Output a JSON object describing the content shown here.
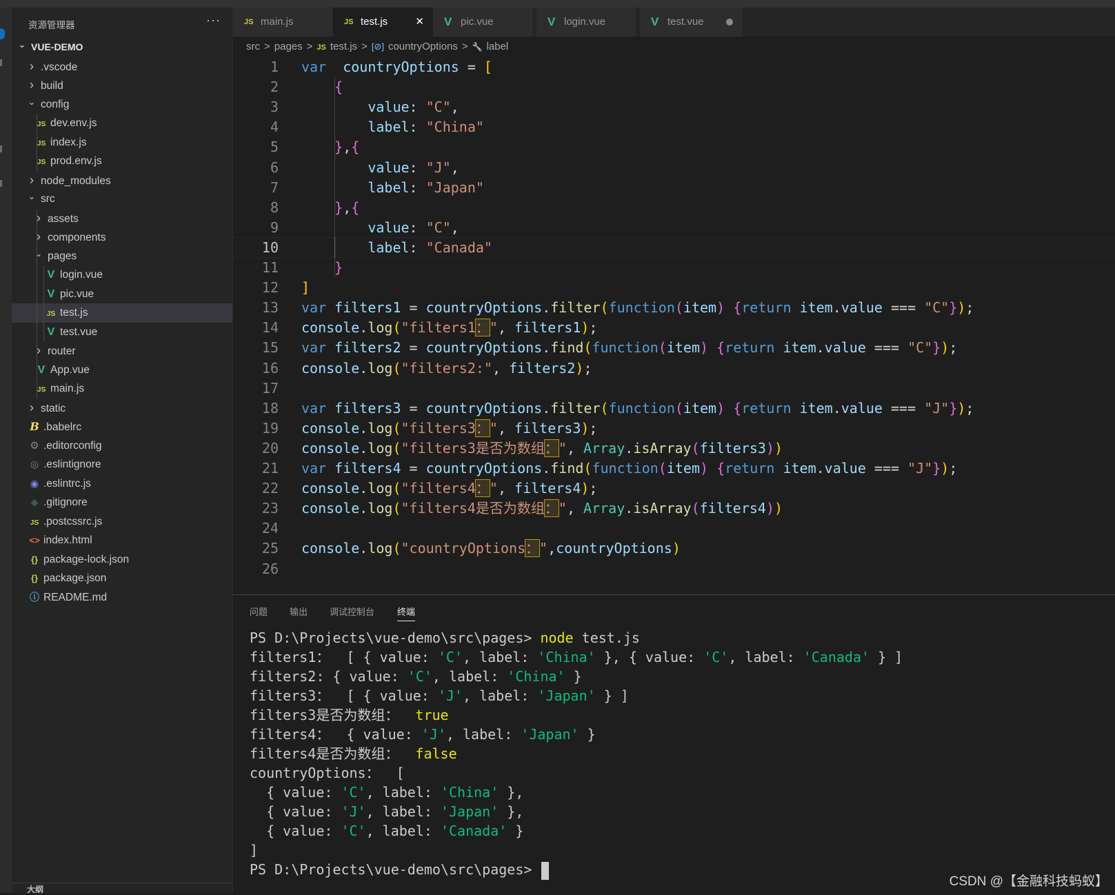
{
  "sidebar": {
    "title": "资源管理器",
    "more": "···",
    "outline_label": "大纲",
    "tree": [
      {
        "label": "VUE-DEMO",
        "depth": 0,
        "chevron": "down",
        "icon": "",
        "root": true
      },
      {
        "label": ".vscode",
        "depth": 1,
        "chevron": "right",
        "icon": ""
      },
      {
        "label": "build",
        "depth": 1,
        "chevron": "right",
        "icon": ""
      },
      {
        "label": "config",
        "depth": 1,
        "chevron": "down",
        "icon": ""
      },
      {
        "label": "dev.env.js",
        "depth": 2,
        "chevron": "",
        "icon": "js"
      },
      {
        "label": "index.js",
        "depth": 2,
        "chevron": "",
        "icon": "js"
      },
      {
        "label": "prod.env.js",
        "depth": 2,
        "chevron": "",
        "icon": "js"
      },
      {
        "label": "node_modules",
        "depth": 1,
        "chevron": "right",
        "icon": ""
      },
      {
        "label": "src",
        "depth": 1,
        "chevron": "down",
        "icon": ""
      },
      {
        "label": "assets",
        "depth": 2,
        "chevron": "right",
        "icon": ""
      },
      {
        "label": "components",
        "depth": 2,
        "chevron": "right",
        "icon": ""
      },
      {
        "label": "pages",
        "depth": 2,
        "chevron": "down",
        "icon": ""
      },
      {
        "label": "login.vue",
        "depth": 3,
        "chevron": "",
        "icon": "vue"
      },
      {
        "label": "pic.vue",
        "depth": 3,
        "chevron": "",
        "icon": "vue"
      },
      {
        "label": "test.js",
        "depth": 3,
        "chevron": "",
        "icon": "js",
        "selected": true
      },
      {
        "label": "test.vue",
        "depth": 3,
        "chevron": "",
        "icon": "vue"
      },
      {
        "label": "router",
        "depth": 2,
        "chevron": "right",
        "icon": ""
      },
      {
        "label": "App.vue",
        "depth": 2,
        "chevron": "",
        "icon": "vue"
      },
      {
        "label": "main.js",
        "depth": 2,
        "chevron": "",
        "icon": "js"
      },
      {
        "label": "static",
        "depth": 1,
        "chevron": "right",
        "icon": ""
      },
      {
        "label": ".babelrc",
        "depth": 1,
        "chevron": "",
        "icon": "babel"
      },
      {
        "label": ".editorconfig",
        "depth": 1,
        "chevron": "",
        "icon": "gear"
      },
      {
        "label": ".eslintignore",
        "depth": 1,
        "chevron": "",
        "icon": "eslint"
      },
      {
        "label": ".eslintrc.js",
        "depth": 1,
        "chevron": "",
        "icon": "eslintrc"
      },
      {
        "label": ".gitignore",
        "depth": 1,
        "chevron": "",
        "icon": "git"
      },
      {
        "label": ".postcssrc.js",
        "depth": 1,
        "chevron": "",
        "icon": "js"
      },
      {
        "label": "index.html",
        "depth": 1,
        "chevron": "",
        "icon": "html"
      },
      {
        "label": "package-lock.json",
        "depth": 1,
        "chevron": "",
        "icon": "json"
      },
      {
        "label": "package.json",
        "depth": 1,
        "chevron": "",
        "icon": "json"
      },
      {
        "label": "README.md",
        "depth": 1,
        "chevron": "",
        "icon": "info"
      }
    ]
  },
  "tabs": [
    {
      "label": "main.js",
      "icon": "js",
      "active": false,
      "state": ""
    },
    {
      "label": "test.js",
      "icon": "js",
      "active": true,
      "state": "close"
    },
    {
      "label": "pic.vue",
      "icon": "vue",
      "active": false,
      "state": ""
    },
    {
      "label": "login.vue",
      "icon": "vue",
      "active": false,
      "state": ""
    },
    {
      "label": "test.vue",
      "icon": "vue",
      "active": false,
      "state": "dirty"
    }
  ],
  "breadcrumb": {
    "segments": [
      "src",
      "pages",
      "test.js",
      "countryOptions",
      "label"
    ],
    "separator": ">"
  },
  "editor": {
    "current_line": 10,
    "lines": [
      [
        [
          "kw",
          "var"
        ],
        [
          "",
          "  "
        ],
        [
          "var",
          "countryOptions"
        ],
        [
          "",
          " = "
        ],
        [
          "b1",
          "["
        ]
      ],
      [
        [
          "",
          "    "
        ],
        [
          "b2",
          "{"
        ]
      ],
      [
        [
          "",
          "        "
        ],
        [
          "var",
          "value"
        ],
        [
          "",
          ": "
        ],
        [
          "str",
          "\"C\""
        ],
        [
          "",
          ","
        ]
      ],
      [
        [
          "",
          "        "
        ],
        [
          "var",
          "label"
        ],
        [
          "",
          ": "
        ],
        [
          "str",
          "\"China\""
        ]
      ],
      [
        [
          "",
          "    "
        ],
        [
          "b2",
          "}"
        ],
        [
          "",
          ","
        ],
        [
          "b2",
          "{"
        ]
      ],
      [
        [
          "",
          "        "
        ],
        [
          "var",
          "value"
        ],
        [
          "",
          ": "
        ],
        [
          "str",
          "\"J\""
        ],
        [
          "",
          ","
        ]
      ],
      [
        [
          "",
          "        "
        ],
        [
          "var",
          "label"
        ],
        [
          "",
          ": "
        ],
        [
          "str",
          "\"Japan\""
        ]
      ],
      [
        [
          "",
          "    "
        ],
        [
          "b2",
          "}"
        ],
        [
          "",
          ","
        ],
        [
          "b2",
          "{"
        ]
      ],
      [
        [
          "",
          "        "
        ],
        [
          "var",
          "value"
        ],
        [
          "",
          ": "
        ],
        [
          "str",
          "\"C\""
        ],
        [
          "",
          ","
        ]
      ],
      [
        [
          "",
          "        "
        ],
        [
          "var",
          "label"
        ],
        [
          "",
          ": "
        ],
        [
          "str",
          "\"Canada\""
        ]
      ],
      [
        [
          "",
          "    "
        ],
        [
          "b2",
          "}"
        ]
      ],
      [
        [
          "b1",
          "]"
        ]
      ],
      [
        [
          "kw",
          "var"
        ],
        [
          "",
          " "
        ],
        [
          "var",
          "filters1"
        ],
        [
          "",
          " = "
        ],
        [
          "var",
          "countryOptions"
        ],
        [
          "",
          "."
        ],
        [
          "fn",
          "filter"
        ],
        [
          "b1",
          "("
        ],
        [
          "kw",
          "function"
        ],
        [
          "b2",
          "("
        ],
        [
          "var",
          "item"
        ],
        [
          "b2",
          ")"
        ],
        [
          "",
          " "
        ],
        [
          "b2",
          "{"
        ],
        [
          "kw",
          "return"
        ],
        [
          "",
          " "
        ],
        [
          "var",
          "item"
        ],
        [
          "",
          "."
        ],
        [
          "var",
          "value"
        ],
        [
          "",
          " === "
        ],
        [
          "str",
          "\"C\""
        ],
        [
          "b2",
          "}"
        ],
        [
          "b1",
          ")"
        ],
        [
          "",
          ";"
        ]
      ],
      [
        [
          "var",
          "console"
        ],
        [
          "",
          "."
        ],
        [
          "fn",
          "log"
        ],
        [
          "b1",
          "("
        ],
        [
          "str",
          "\"filters1"
        ],
        [
          "strhl",
          "："
        ],
        [
          "str",
          "\""
        ],
        [
          "",
          ", "
        ],
        [
          "var",
          "filters1"
        ],
        [
          "b1",
          ")"
        ],
        [
          "",
          ";"
        ]
      ],
      [
        [
          "kw",
          "var"
        ],
        [
          "",
          " "
        ],
        [
          "var",
          "filters2"
        ],
        [
          "",
          " = "
        ],
        [
          "var",
          "countryOptions"
        ],
        [
          "",
          "."
        ],
        [
          "fn",
          "find"
        ],
        [
          "b1",
          "("
        ],
        [
          "kw",
          "function"
        ],
        [
          "b2",
          "("
        ],
        [
          "var",
          "item"
        ],
        [
          "b2",
          ")"
        ],
        [
          "",
          " "
        ],
        [
          "b2",
          "{"
        ],
        [
          "kw",
          "return"
        ],
        [
          "",
          " "
        ],
        [
          "var",
          "item"
        ],
        [
          "",
          "."
        ],
        [
          "var",
          "value"
        ],
        [
          "",
          " === "
        ],
        [
          "str",
          "\"C\""
        ],
        [
          "b2",
          "}"
        ],
        [
          "b1",
          ")"
        ],
        [
          "",
          ";"
        ]
      ],
      [
        [
          "var",
          "console"
        ],
        [
          "",
          "."
        ],
        [
          "fn",
          "log"
        ],
        [
          "b1",
          "("
        ],
        [
          "str",
          "\"filters2:\""
        ],
        [
          "",
          ", "
        ],
        [
          "var",
          "filters2"
        ],
        [
          "b1",
          ")"
        ],
        [
          "",
          ";"
        ]
      ],
      [],
      [
        [
          "kw",
          "var"
        ],
        [
          "",
          " "
        ],
        [
          "var",
          "filters3"
        ],
        [
          "",
          " = "
        ],
        [
          "var",
          "countryOptions"
        ],
        [
          "",
          "."
        ],
        [
          "fn",
          "filter"
        ],
        [
          "b1",
          "("
        ],
        [
          "kw",
          "function"
        ],
        [
          "b2",
          "("
        ],
        [
          "var",
          "item"
        ],
        [
          "b2",
          ")"
        ],
        [
          "",
          " "
        ],
        [
          "b2",
          "{"
        ],
        [
          "kw",
          "return"
        ],
        [
          "",
          " "
        ],
        [
          "var",
          "item"
        ],
        [
          "",
          "."
        ],
        [
          "var",
          "value"
        ],
        [
          "",
          " === "
        ],
        [
          "str",
          "\"J\""
        ],
        [
          "b2",
          "}"
        ],
        [
          "b1",
          ")"
        ],
        [
          "",
          ";"
        ]
      ],
      [
        [
          "var",
          "console"
        ],
        [
          "",
          "."
        ],
        [
          "fn",
          "log"
        ],
        [
          "b1",
          "("
        ],
        [
          "str",
          "\"filters3"
        ],
        [
          "strhl",
          "："
        ],
        [
          "str",
          "\""
        ],
        [
          "",
          ", "
        ],
        [
          "var",
          "filters3"
        ],
        [
          "b1",
          ")"
        ],
        [
          "",
          ";"
        ]
      ],
      [
        [
          "var",
          "console"
        ],
        [
          "",
          "."
        ],
        [
          "fn",
          "log"
        ],
        [
          "b1",
          "("
        ],
        [
          "str",
          "\"filters3是否为数组"
        ],
        [
          "strhl",
          "："
        ],
        [
          "str",
          "\""
        ],
        [
          "",
          ", "
        ],
        [
          "type",
          "Array"
        ],
        [
          "",
          "."
        ],
        [
          "fn",
          "isArray"
        ],
        [
          "b2",
          "("
        ],
        [
          "var",
          "filters3"
        ],
        [
          "b2",
          ")"
        ],
        [
          "b1",
          ")"
        ]
      ],
      [
        [
          "kw",
          "var"
        ],
        [
          "",
          " "
        ],
        [
          "var",
          "filters4"
        ],
        [
          "",
          " = "
        ],
        [
          "var",
          "countryOptions"
        ],
        [
          "",
          "."
        ],
        [
          "fn",
          "find"
        ],
        [
          "b1",
          "("
        ],
        [
          "kw",
          "function"
        ],
        [
          "b2",
          "("
        ],
        [
          "var",
          "item"
        ],
        [
          "b2",
          ")"
        ],
        [
          "",
          " "
        ],
        [
          "b2",
          "{"
        ],
        [
          "kw",
          "return"
        ],
        [
          "",
          " "
        ],
        [
          "var",
          "item"
        ],
        [
          "",
          "."
        ],
        [
          "var",
          "value"
        ],
        [
          "",
          " === "
        ],
        [
          "str",
          "\"J\""
        ],
        [
          "b2",
          "}"
        ],
        [
          "b1",
          ")"
        ],
        [
          "",
          ";"
        ]
      ],
      [
        [
          "var",
          "console"
        ],
        [
          "",
          "."
        ],
        [
          "fn",
          "log"
        ],
        [
          "b1",
          "("
        ],
        [
          "str",
          "\"filters4"
        ],
        [
          "strhl",
          "："
        ],
        [
          "str",
          "\""
        ],
        [
          "",
          ", "
        ],
        [
          "var",
          "filters4"
        ],
        [
          "b1",
          ")"
        ],
        [
          "",
          ";"
        ]
      ],
      [
        [
          "var",
          "console"
        ],
        [
          "",
          "."
        ],
        [
          "fn",
          "log"
        ],
        [
          "b1",
          "("
        ],
        [
          "str",
          "\"filters4是否为数组"
        ],
        [
          "strhl",
          "："
        ],
        [
          "str",
          "\""
        ],
        [
          "",
          ", "
        ],
        [
          "type",
          "Array"
        ],
        [
          "",
          "."
        ],
        [
          "fn",
          "isArray"
        ],
        [
          "b2",
          "("
        ],
        [
          "var",
          "filters4"
        ],
        [
          "b2",
          ")"
        ],
        [
          "b1",
          ")"
        ]
      ],
      [],
      [
        [
          "var",
          "console"
        ],
        [
          "",
          "."
        ],
        [
          "fn",
          "log"
        ],
        [
          "b1",
          "("
        ],
        [
          "str",
          "\"countryOptions"
        ],
        [
          "strhl",
          "："
        ],
        [
          "str",
          "\""
        ],
        [
          "",
          ","
        ],
        [
          "var",
          "countryOptions"
        ],
        [
          "b1",
          ")"
        ]
      ],
      []
    ]
  },
  "panel": {
    "tabs": [
      "问题",
      "输出",
      "调试控制台",
      "终端"
    ],
    "active_tab": 3,
    "terminal": [
      [
        [
          "",
          "PS D:\\Projects\\vue-demo\\src\\pages> "
        ],
        [
          "y",
          "node"
        ],
        [
          "",
          " test.js"
        ]
      ],
      [
        [
          "",
          "filters1：  [ { value: "
        ],
        [
          "g",
          "'C'"
        ],
        [
          "",
          ", label: "
        ],
        [
          "g",
          "'China'"
        ],
        [
          "",
          " }, { value: "
        ],
        [
          "g",
          "'C'"
        ],
        [
          "",
          ", label: "
        ],
        [
          "g",
          "'Canada'"
        ],
        [
          "",
          " } ]"
        ]
      ],
      [
        [
          "",
          "filters2: { value: "
        ],
        [
          "g",
          "'C'"
        ],
        [
          "",
          ", label: "
        ],
        [
          "g",
          "'China'"
        ],
        [
          "",
          " }"
        ]
      ],
      [
        [
          "",
          "filters3：  [ { value: "
        ],
        [
          "g",
          "'J'"
        ],
        [
          "",
          ", label: "
        ],
        [
          "g",
          "'Japan'"
        ],
        [
          "",
          " } ]"
        ]
      ],
      [
        [
          "",
          "filters3是否为数组：  "
        ],
        [
          "y",
          "true"
        ]
      ],
      [
        [
          "",
          "filters4：  { value: "
        ],
        [
          "g",
          "'J'"
        ],
        [
          "",
          ", label: "
        ],
        [
          "g",
          "'Japan'"
        ],
        [
          "",
          " }"
        ]
      ],
      [
        [
          "",
          "filters4是否为数组：  "
        ],
        [
          "y",
          "false"
        ]
      ],
      [
        [
          "",
          "countryOptions：  ["
        ]
      ],
      [
        [
          "",
          "  { value: "
        ],
        [
          "g",
          "'C'"
        ],
        [
          "",
          ", label: "
        ],
        [
          "g",
          "'China'"
        ],
        [
          "",
          " },"
        ]
      ],
      [
        [
          "",
          "  { value: "
        ],
        [
          "g",
          "'J'"
        ],
        [
          "",
          ", label: "
        ],
        [
          "g",
          "'Japan'"
        ],
        [
          "",
          " },"
        ]
      ],
      [
        [
          "",
          "  { value: "
        ],
        [
          "g",
          "'C'"
        ],
        [
          "",
          ", label: "
        ],
        [
          "g",
          "'Canada'"
        ],
        [
          "",
          " }"
        ]
      ],
      [
        [
          "",
          "]"
        ]
      ],
      [
        [
          "",
          "PS D:\\Projects\\vue-demo\\src\\pages> "
        ]
      ]
    ]
  },
  "watermark": "CSDN @【金融科技蚂蚁】"
}
